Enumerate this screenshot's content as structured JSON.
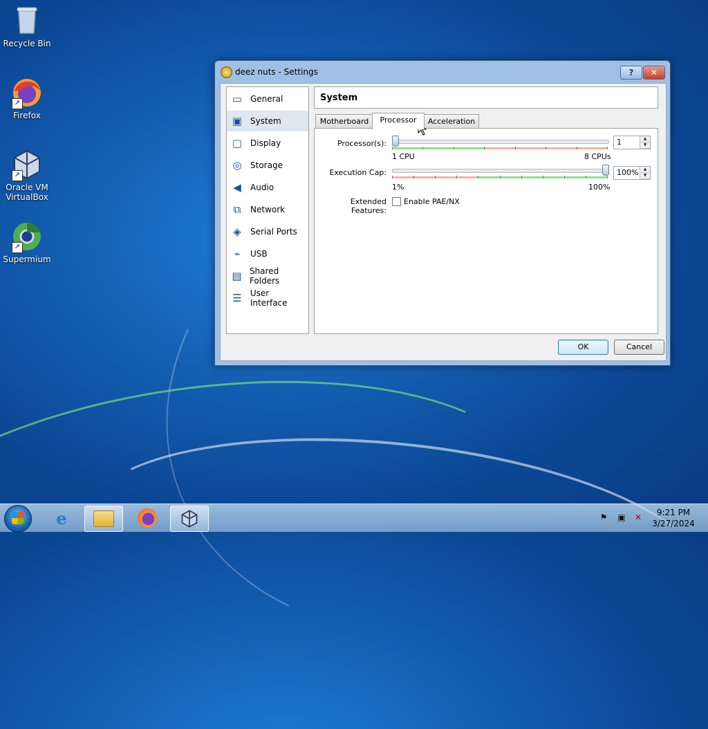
{
  "desktop": {
    "icons": [
      {
        "label": "Recycle Bin",
        "icon": "recycle-bin-icon"
      },
      {
        "label": "Firefox",
        "icon": "firefox-icon"
      },
      {
        "label": "Oracle VM VirtualBox",
        "icon": "virtualbox-icon"
      },
      {
        "label": "Supermium",
        "icon": "supermium-icon"
      }
    ]
  },
  "dialog": {
    "title": "deez nuts - Settings",
    "help_label": "?",
    "close_label": "✕",
    "sidebar": [
      {
        "label": "General",
        "icon": "general-icon"
      },
      {
        "label": "System",
        "icon": "system-icon",
        "active": true
      },
      {
        "label": "Display",
        "icon": "display-icon"
      },
      {
        "label": "Storage",
        "icon": "storage-icon"
      },
      {
        "label": "Audio",
        "icon": "audio-icon"
      },
      {
        "label": "Network",
        "icon": "network-icon"
      },
      {
        "label": "Serial Ports",
        "icon": "serial-ports-icon"
      },
      {
        "label": "USB",
        "icon": "usb-icon"
      },
      {
        "label": "Shared Folders",
        "icon": "shared-folders-icon"
      },
      {
        "label": "User Interface",
        "icon": "user-interface-icon"
      }
    ],
    "section_title": "System",
    "tabs": [
      {
        "label": "Motherboard"
      },
      {
        "label": "Processor",
        "active": true
      },
      {
        "label": "Acceleration"
      }
    ],
    "processor": {
      "processors_label": "Processor(s):",
      "processors_value": "1",
      "processors_min_label": "1 CPU",
      "processors_max_label": "8 CPUs",
      "processors_min": 1,
      "processors_max": 8,
      "processors_current": 1,
      "execution_cap_label": "Execution Cap:",
      "execution_cap_value": "100%",
      "execution_cap_min_label": "1%",
      "execution_cap_max_label": "100%",
      "execution_cap_current": 100,
      "extended_features_label": "Extended Features:",
      "pae_label": "Enable PAE/NX",
      "pae_checked": false
    },
    "ok_label": "OK",
    "cancel_label": "Cancel"
  },
  "taskbar": {
    "apps": [
      {
        "name": "internet-explorer-icon"
      },
      {
        "name": "file-explorer-icon"
      },
      {
        "name": "firefox-icon"
      },
      {
        "name": "virtualbox-icon"
      }
    ],
    "clock_time": "9:21 PM",
    "clock_date": "3/27/2024"
  },
  "colors": {
    "green_zone": "#8ee08e",
    "red_zone": "#f0b5a0",
    "accent": "#3c7fb1"
  }
}
